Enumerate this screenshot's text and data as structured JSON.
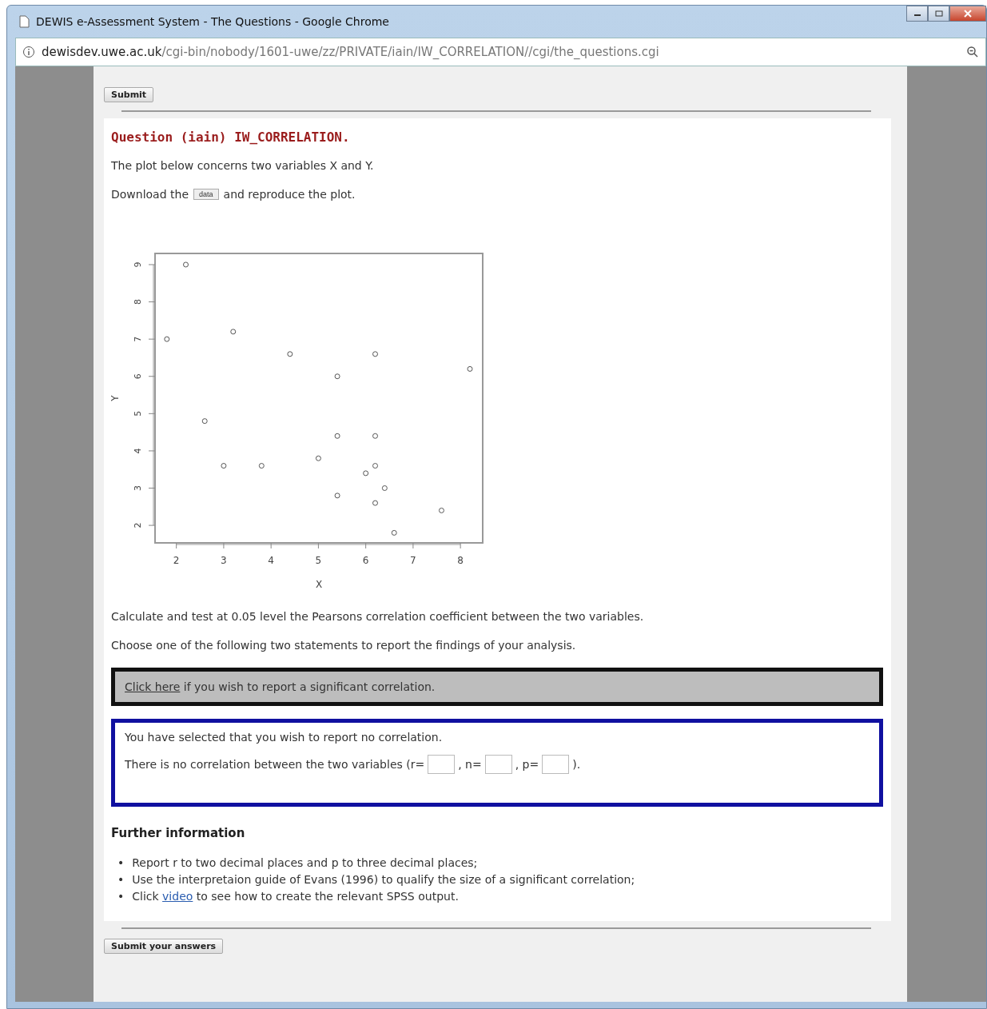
{
  "window": {
    "title": "DEWIS e-Assessment System - The Questions - Google Chrome"
  },
  "address_bar": {
    "host": "dewisdev.uwe.ac.uk",
    "path": "/cgi-bin/nobody/1601-uwe/zz/PRIVATE/iain/IW_CORRELATION//cgi/the_questions.cgi"
  },
  "top_button": "Submit",
  "question": {
    "title": "Question (iain) IW_CORRELATION.",
    "intro": "The plot below concerns two variables X and Y.",
    "download_before": "Download the",
    "download_button": "data",
    "download_after": "and reproduce the plot.",
    "chart_data": {
      "type": "scatter",
      "xlabel": "X",
      "ylabel": "Y",
      "x": [
        2.2,
        1.8,
        3.2,
        4.4,
        6.2,
        8.2,
        5.4,
        2.6,
        5.4,
        6.2,
        5.0,
        3.0,
        3.8,
        6.2,
        6.0,
        6.4,
        5.4,
        6.2,
        7.6,
        6.6
      ],
      "series": [
        {
          "color": "#555555",
          "values": [
            9,
            7,
            7.2,
            6.6,
            6.6,
            6.2,
            6.0,
            4.8,
            4.4,
            4.4,
            3.8,
            3.6,
            3.6,
            3.6,
            3.4,
            3.0,
            2.8,
            2.6,
            2.4,
            1.8
          ]
        }
      ],
      "xlim": [
        1.55,
        8.47
      ],
      "ylim": [
        1.53,
        9.3
      ],
      "xticks": [
        2,
        3,
        4,
        5,
        6,
        7,
        8
      ],
      "yticks": [
        2,
        3,
        4,
        5,
        6,
        7,
        8,
        9
      ]
    },
    "task": "Calculate and test at 0.05 level the Pearsons correlation coefficient between the two variables.",
    "choose": "Choose one of the following two statements to report the findings of your analysis.",
    "options": [
      {
        "selected": false,
        "link": "Click here",
        "text": "if you wish to report a significant correlation."
      },
      {
        "selected": true,
        "text": "You have selected that you wish to report no correlation.",
        "statement": "There is no correlation between the two variables (r=",
        "fields": [
          {
            "after": ", n="
          },
          {
            "after": ", p="
          },
          {
            "after": ")."
          }
        ]
      }
    ],
    "further": {
      "heading": "Further information",
      "items": [
        {
          "marker": "•",
          "text": "Report r to two decimal places and p to three decimal places;"
        },
        {
          "marker": "•",
          "text": "Use the interpretaion guide of Evans (1996) to qualify the size of a significant correlation;"
        },
        {
          "marker": "•",
          "before": "Click",
          "link": "video",
          "text": "to see how to create the relevant SPSS output."
        }
      ]
    }
  },
  "bottom_button": "Submit your answers"
}
